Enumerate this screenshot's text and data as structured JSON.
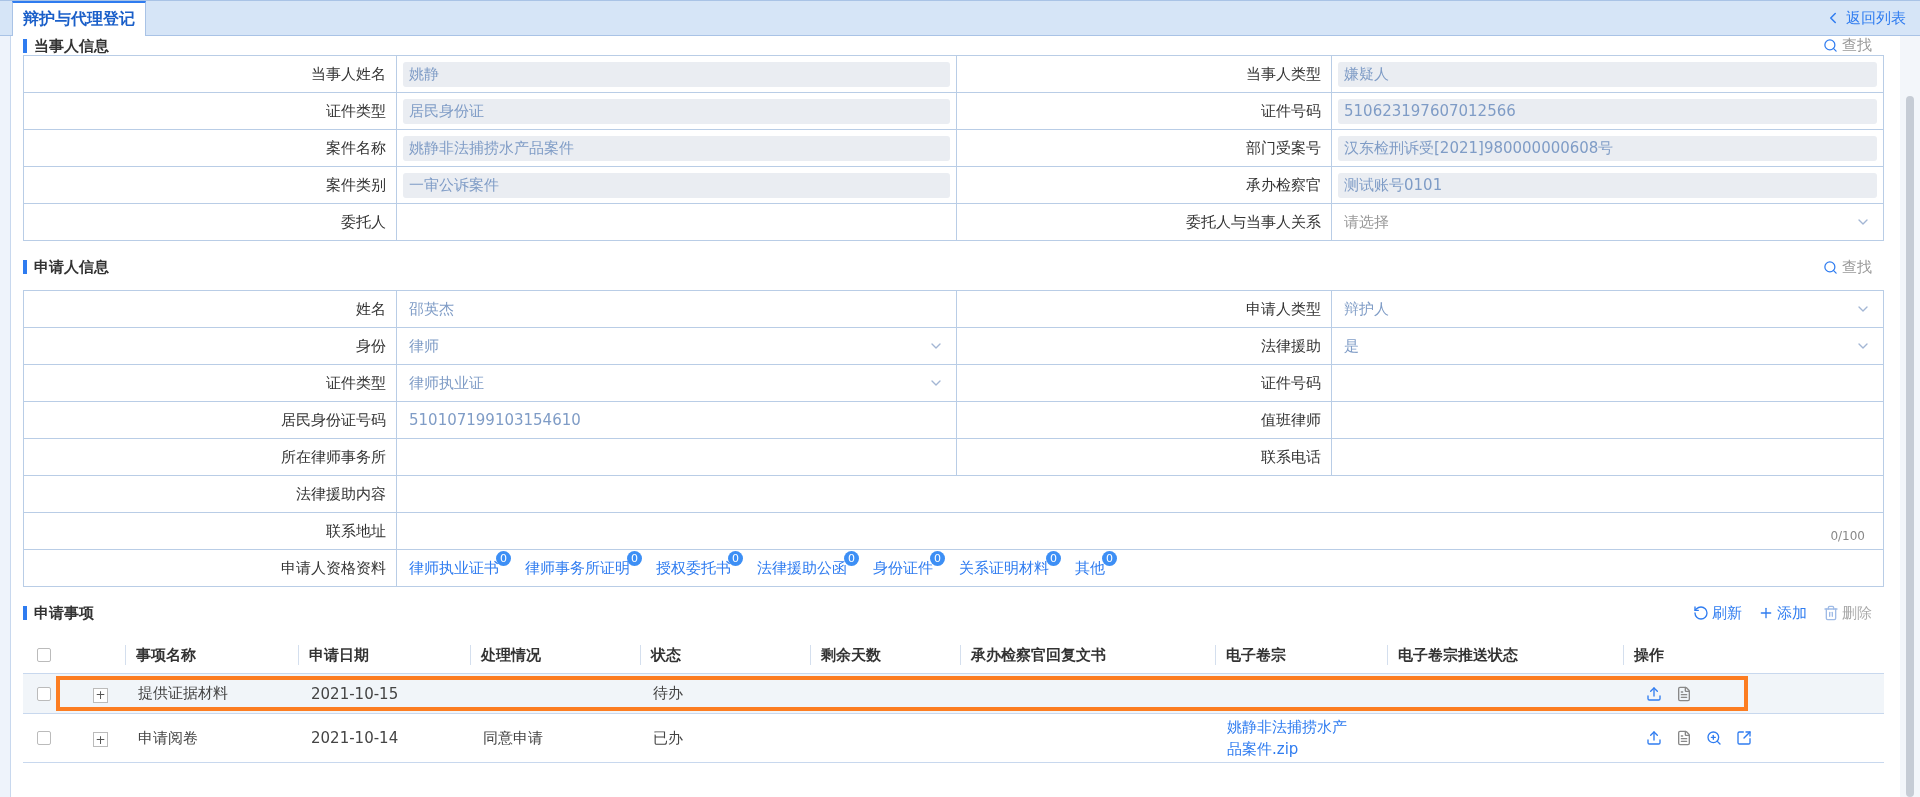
{
  "tabs": [
    {
      "label": "辩护与代理登记",
      "selected": true
    }
  ],
  "back_link": "返回列表",
  "party_section": {
    "title": "当事人信息",
    "find": "查找",
    "rows": [
      {
        "left": {
          "label": "当事人姓名",
          "kind": "readonly",
          "value": "姚静"
        },
        "right": {
          "label": "当事人类型",
          "kind": "readonly",
          "value": "嫌疑人"
        }
      },
      {
        "left": {
          "label": "证件类型",
          "kind": "readonly",
          "value": "居民身份证"
        },
        "right": {
          "label": "证件号码",
          "kind": "readonly",
          "value": "510623197607012566"
        }
      },
      {
        "left": {
          "label": "案件名称",
          "kind": "readonly",
          "value": "姚静非法捕捞水产品案件"
        },
        "right": {
          "label": "部门受案号",
          "kind": "readonly",
          "value": "汉东检刑诉受[2021]980000000608号"
        }
      },
      {
        "left": {
          "label": "案件类别",
          "kind": "readonly",
          "value": "一审公诉案件"
        },
        "right": {
          "label": "承办检察官",
          "kind": "readonly",
          "value": "测试账号0101"
        }
      },
      {
        "left": {
          "label": "委托人",
          "kind": "text"
        },
        "right": {
          "label": "委托人与当事人关系",
          "kind": "select",
          "placeholder": "请选择"
        }
      }
    ]
  },
  "applicant_section": {
    "title": "申请人信息",
    "find": "查找",
    "rows": [
      {
        "left": {
          "label": "姓名",
          "kind": "text",
          "value": "邵英杰"
        },
        "right": {
          "label": "申请人类型",
          "kind": "select",
          "value": "辩护人"
        }
      },
      {
        "left": {
          "label": "身份",
          "kind": "select",
          "value": "律师"
        },
        "right": {
          "label": "法律援助",
          "kind": "select",
          "value": "是"
        }
      },
      {
        "left": {
          "label": "证件类型",
          "kind": "select",
          "value": "律师执业证"
        },
        "right": {
          "label": "证件号码",
          "kind": "text"
        }
      },
      {
        "left": {
          "label": "居民身份证号码",
          "kind": "text",
          "value": "510107199103154610"
        },
        "right": {
          "label": "值班律师",
          "kind": "text"
        }
      },
      {
        "left": {
          "label": "所在律师事务所",
          "kind": "text"
        },
        "right": {
          "label": "联系电话",
          "kind": "text"
        }
      },
      {
        "full": {
          "label": "法律援助内容",
          "kind": "text"
        }
      },
      {
        "full": {
          "label": "联系地址",
          "kind": "textarea",
          "counter": "0/100"
        }
      },
      {
        "full": {
          "label": "申请人资格资料",
          "kind": "attachments",
          "items": [
            {
              "label": "律师执业证书",
              "count": "0"
            },
            {
              "label": "律师事务所证明",
              "count": "0"
            },
            {
              "label": "授权委托书",
              "count": "0"
            },
            {
              "label": "法律援助公函",
              "count": "0"
            },
            {
              "label": "身份证件",
              "count": "0"
            },
            {
              "label": "关系证明材料",
              "count": "0"
            },
            {
              "label": "其他",
              "count": "0"
            }
          ]
        }
      }
    ]
  },
  "items_section": {
    "title": "申请事项",
    "actions": [
      {
        "kind": "refresh",
        "label": "刷新",
        "disabled": false
      },
      {
        "kind": "add",
        "label": "添加",
        "disabled": false
      },
      {
        "kind": "delete",
        "label": "删除",
        "disabled": true
      }
    ],
    "all_checked": false,
    "columns": [
      "事项名称",
      "申请日期",
      "处理情况",
      "状态",
      "剩余天数",
      "承办检察官回复文书",
      "电子卷宗",
      "电子卷宗推送状态",
      "操作"
    ],
    "rows": [
      {
        "checked": false,
        "highlighted": true,
        "expand": "+",
        "name": "提供证据材料",
        "date": "2021-10-15",
        "status": "待办",
        "actions": [
          {
            "kind": "upload"
          },
          {
            "kind": "document"
          }
        ]
      },
      {
        "checked": false,
        "highlighted": false,
        "expand": "+",
        "name": "申请阅卷",
        "date": "2021-10-14",
        "handling": "同意申请",
        "status": "已办",
        "file": "姚静非法捕捞水产品案件.zip",
        "actions": [
          {
            "kind": "upload"
          },
          {
            "kind": "document"
          },
          {
            "kind": "zoom"
          },
          {
            "kind": "share"
          }
        ]
      }
    ]
  }
}
